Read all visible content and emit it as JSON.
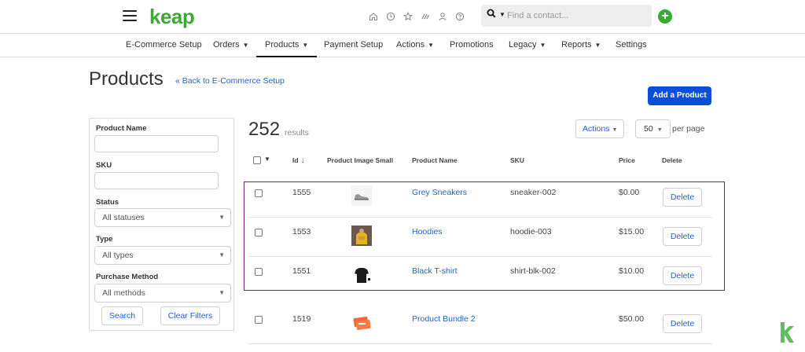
{
  "brand": {
    "logo_text": "keap",
    "accent": "#3aaa35",
    "link_color": "#2563c9",
    "primary_button": "#0b4fd8",
    "highlight_border": "#7b1f7e"
  },
  "topbar": {
    "icons": [
      "home-icon",
      "clock-icon",
      "star-icon",
      "quick-actions-icon",
      "user-icon",
      "help-icon"
    ],
    "search_placeholder": "Find a contact..."
  },
  "subnav": [
    {
      "label": "E-Commerce Setup",
      "dropdown": false
    },
    {
      "label": "Orders",
      "dropdown": true
    },
    {
      "label": "Products",
      "dropdown": true,
      "active": true
    },
    {
      "label": "Payment Setup",
      "dropdown": false
    },
    {
      "label": "Actions",
      "dropdown": true
    },
    {
      "label": "Promotions",
      "dropdown": false
    },
    {
      "label": "Legacy",
      "dropdown": true
    },
    {
      "label": "Reports",
      "dropdown": true
    },
    {
      "label": "Settings",
      "dropdown": false
    }
  ],
  "page": {
    "title": "Products",
    "back_link": "« Back to E-Commerce Setup",
    "add_button": "Add a Product"
  },
  "filters": {
    "product_name_label": "Product Name",
    "sku_label": "SKU",
    "status_label": "Status",
    "status_value": "All statuses",
    "type_label": "Type",
    "type_value": "All types",
    "purchase_method_label": "Purchase Method",
    "purchase_method_value": "All methods",
    "search_button": "Search",
    "clear_button": "Clear Filters"
  },
  "results": {
    "count": "252",
    "count_label": "results",
    "actions_label": "Actions",
    "per_page_value": "50",
    "per_page_label": "per page"
  },
  "table": {
    "headers": {
      "id": "Id",
      "image": "Product Image Small",
      "name": "Product Name",
      "sku": "SKU",
      "price": "Price",
      "delete": "Delete"
    },
    "rows": [
      {
        "id": "1555",
        "name": "Grey Sneakers",
        "sku": "sneaker-002",
        "price": "$0.00",
        "delete": "Delete",
        "thumb": "sneaker"
      },
      {
        "id": "1553",
        "name": "Hoodies",
        "sku": "hoodie-003",
        "price": "$15.00",
        "delete": "Delete",
        "thumb": "hoodie"
      },
      {
        "id": "1551",
        "name": "Black T-shirt",
        "sku": "shirt-blk-002",
        "price": "$10.00",
        "delete": "Delete",
        "thumb": "tshirt"
      },
      {
        "id": "1519",
        "name": "Product Bundle 2",
        "sku": "",
        "price": "$50.00",
        "delete": "Delete",
        "thumb": "bundle"
      }
    ]
  }
}
